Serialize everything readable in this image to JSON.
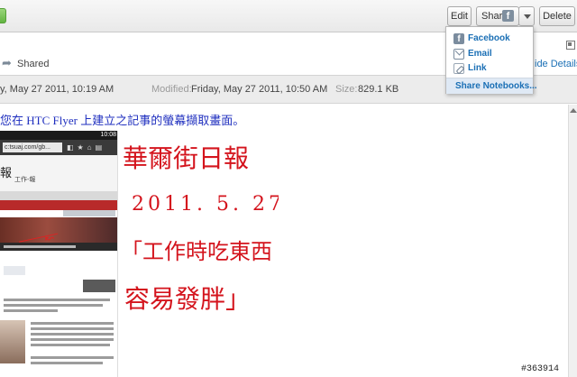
{
  "toolbar": {
    "edit_label": "Edit",
    "share_label": "Share",
    "delete_label": "Delete"
  },
  "share_menu": {
    "items": [
      {
        "label": "Facebook",
        "icon": "facebook-icon"
      },
      {
        "label": "Email",
        "icon": "email-icon"
      },
      {
        "label": "Link",
        "icon": "link-icon"
      }
    ],
    "share_notebooks_label": "Share Notebooks..."
  },
  "shared_bar": {
    "shared_label": "Shared",
    "hide_details_label": "ide Details"
  },
  "meta": {
    "created_value": "y, May 27 2011, 10:19 AM",
    "modified_label": "Modified:",
    "modified_value": "Friday, May 27 2011, 10:50 AM",
    "size_label": "Size:",
    "size_value": "829.1 KB"
  },
  "note": {
    "caption": "您在 HTC Flyer 上建立之記事的螢幕擷取畫面。",
    "embedded_screenshot": {
      "url_text": "c:tsuaj.com/gb...",
      "logo_text": "報",
      "logo_sub": "工作-報",
      "clock": "10:08"
    },
    "handwriting": [
      "華爾街日報",
      "2011. 5. 27",
      "「工作時吃東西",
      "容易發胖」"
    ]
  },
  "watermark": "#363914",
  "colors": {
    "link_blue": "#1a6fb5",
    "caption_blue": "#1f2fbf",
    "ink_red": "#d4141d",
    "menu_highlight": "#dfe9f5"
  }
}
